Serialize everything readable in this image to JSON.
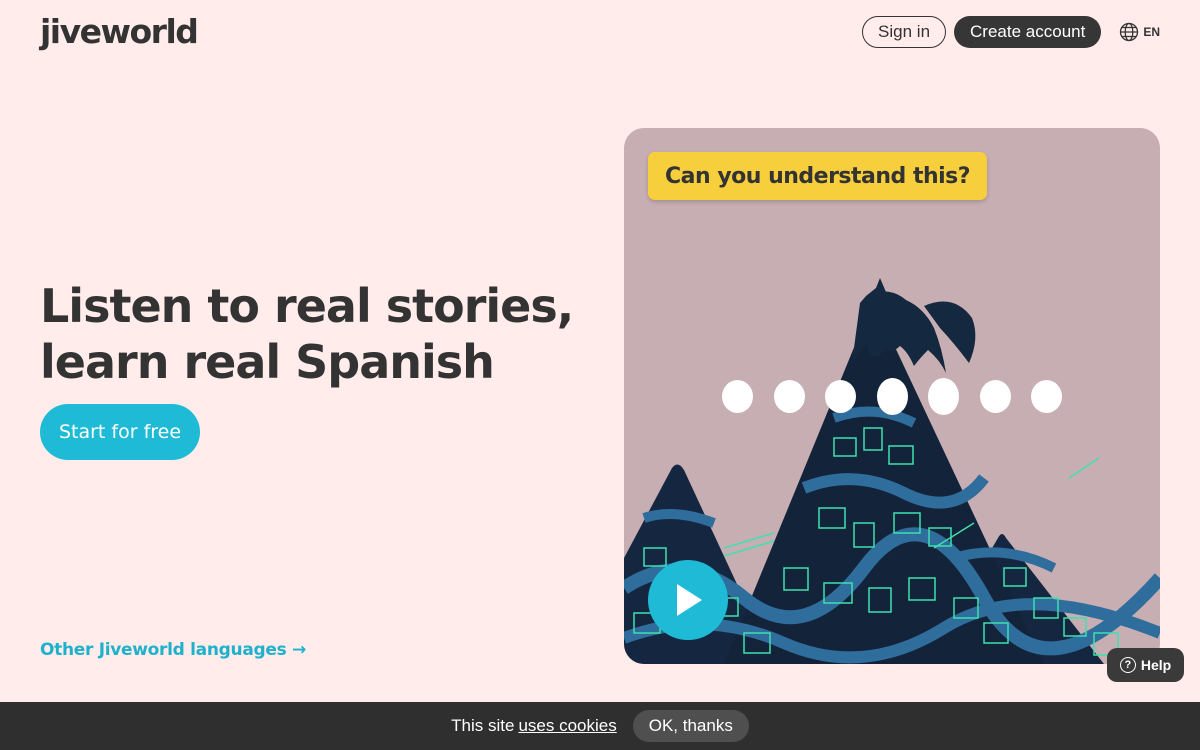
{
  "header": {
    "logo_text": "jiveworld",
    "signin_label": "Sign in",
    "create_account_label": "Create account",
    "language_code": "EN",
    "language_icon": "globe-icon"
  },
  "hero": {
    "headline_line1": "Listen to real stories,",
    "headline_line2": "learn real Spanish",
    "cta_label": "Start for free",
    "other_languages_link": "Other Jiveworld languages →"
  },
  "media_card": {
    "label": "Can you understand this?",
    "dot_count": 7,
    "play_icon": "play-icon"
  },
  "help_button": {
    "label": "Help",
    "icon": "question-icon"
  },
  "cookie_bar": {
    "text": "This site",
    "link_text": "uses cookies",
    "ok_label": "OK, thanks"
  },
  "colors": {
    "background": "#ffeceb",
    "accent": "#1fbbd6",
    "label_yellow": "#f7cf3d",
    "card_bg": "#c7aeb3",
    "dark": "#363636"
  }
}
